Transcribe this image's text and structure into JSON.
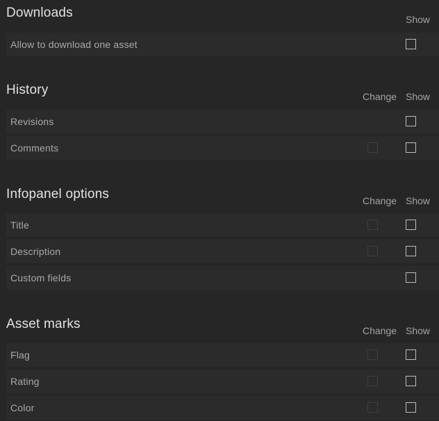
{
  "sections": [
    {
      "title": "Downloads",
      "show_header": "Show",
      "rows": [
        {
          "label": "Allow to download one asset",
          "show_checked": false
        }
      ]
    },
    {
      "title": "History",
      "change_header": "Change",
      "show_header": "Show",
      "rows": [
        {
          "label": "Revisions",
          "show_checked": false
        },
        {
          "label": "Comments",
          "change_checked": false,
          "change_disabled": true,
          "show_checked": false
        }
      ]
    },
    {
      "title": "Infopanel options",
      "change_header": "Change",
      "show_header": "Show",
      "rows": [
        {
          "label": "Title",
          "change_checked": false,
          "change_disabled": true,
          "show_checked": false
        },
        {
          "label": "Description",
          "change_checked": false,
          "change_disabled": true,
          "show_checked": false
        },
        {
          "label": "Custom fields",
          "show_checked": false
        }
      ]
    },
    {
      "title": "Asset marks",
      "change_header": "Change",
      "show_header": "Show",
      "rows": [
        {
          "label": "Flag",
          "change_checked": false,
          "change_disabled": true,
          "show_checked": false
        },
        {
          "label": "Rating",
          "change_checked": false,
          "change_disabled": true,
          "show_checked": false
        },
        {
          "label": "Color",
          "change_checked": false,
          "change_disabled": true,
          "show_checked": false
        }
      ]
    }
  ],
  "colors": {
    "background": "#262626",
    "row_background": "#2b2b2b",
    "title_text": "#e2e2e2",
    "label_text": "#a9a9a9",
    "checkbox_border": "#bdbdbd",
    "checkbox_disabled_border": "#3e3e3e"
  }
}
